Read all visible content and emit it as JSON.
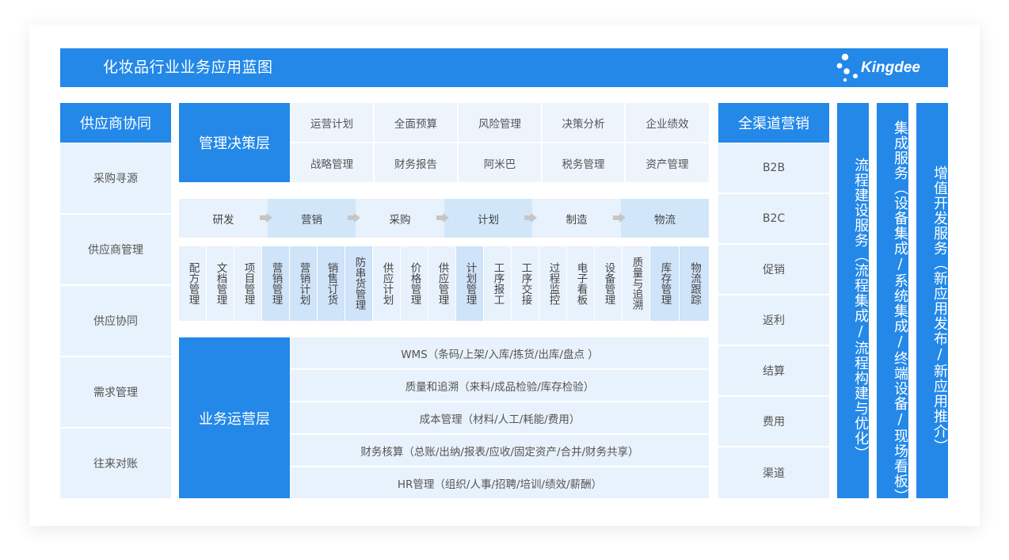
{
  "title": "化妆品行业业务应用蓝图",
  "logo": {
    "text": "Kingdee",
    "icon": "kingdee-dots-logo"
  },
  "supplier": {
    "header": "供应商协同",
    "items": [
      "采购寻源",
      "供应商管理",
      "供应协同",
      "需求管理",
      "往来对账"
    ]
  },
  "management": {
    "header": "管理决策层",
    "items": [
      "运营计划",
      "全面预算",
      "风险管理",
      "决策分析",
      "企业绩效",
      "战略管理",
      "财务报告",
      "阿米巴",
      "税务管理",
      "资产管理"
    ]
  },
  "process": [
    "研发",
    "营销",
    "采购",
    "计划",
    "制造",
    "物流"
  ],
  "modules": [
    "配方管理",
    "文档管理",
    "项目管理",
    "营销管理",
    "营销计划",
    "销售订货",
    "防串货管理",
    "供应计划",
    "价格管理",
    "供应管理",
    "计划管理",
    "工序报工",
    "工序交接",
    "过程监控",
    "电子看板",
    "设备管理",
    "质量与追溯",
    "库存管理",
    "物流跟踪"
  ],
  "operations": {
    "header": "业务运营层",
    "items": [
      "WMS（条码/上架/入库/拣货/出库/盘点 ）",
      "质量和追溯（来料/成品检验/库存检验）",
      "成本管理（材料/人工/耗能/费用）",
      "财务核算（总账/出纳/报表/应收/固定资产/合并/财务共享）",
      "HR管理（组织/人事/招聘/培训/绩效/薪酬）"
    ]
  },
  "omni": {
    "header": "全渠道营销",
    "items": [
      "B2B",
      "B2C",
      "促销",
      "返利",
      "结算",
      "费用",
      "渠道"
    ]
  },
  "services": [
    "流程建设服务（流程集成/流程构建与优化）",
    "集成服务（设备集成/系统集成/终端设备/现场看板）",
    "增值开发服务（新应用发布/新应用推介）"
  ],
  "colors": {
    "primary": "#2388e8",
    "light": "#e8f2fc",
    "medium": "#d2e6fa"
  }
}
